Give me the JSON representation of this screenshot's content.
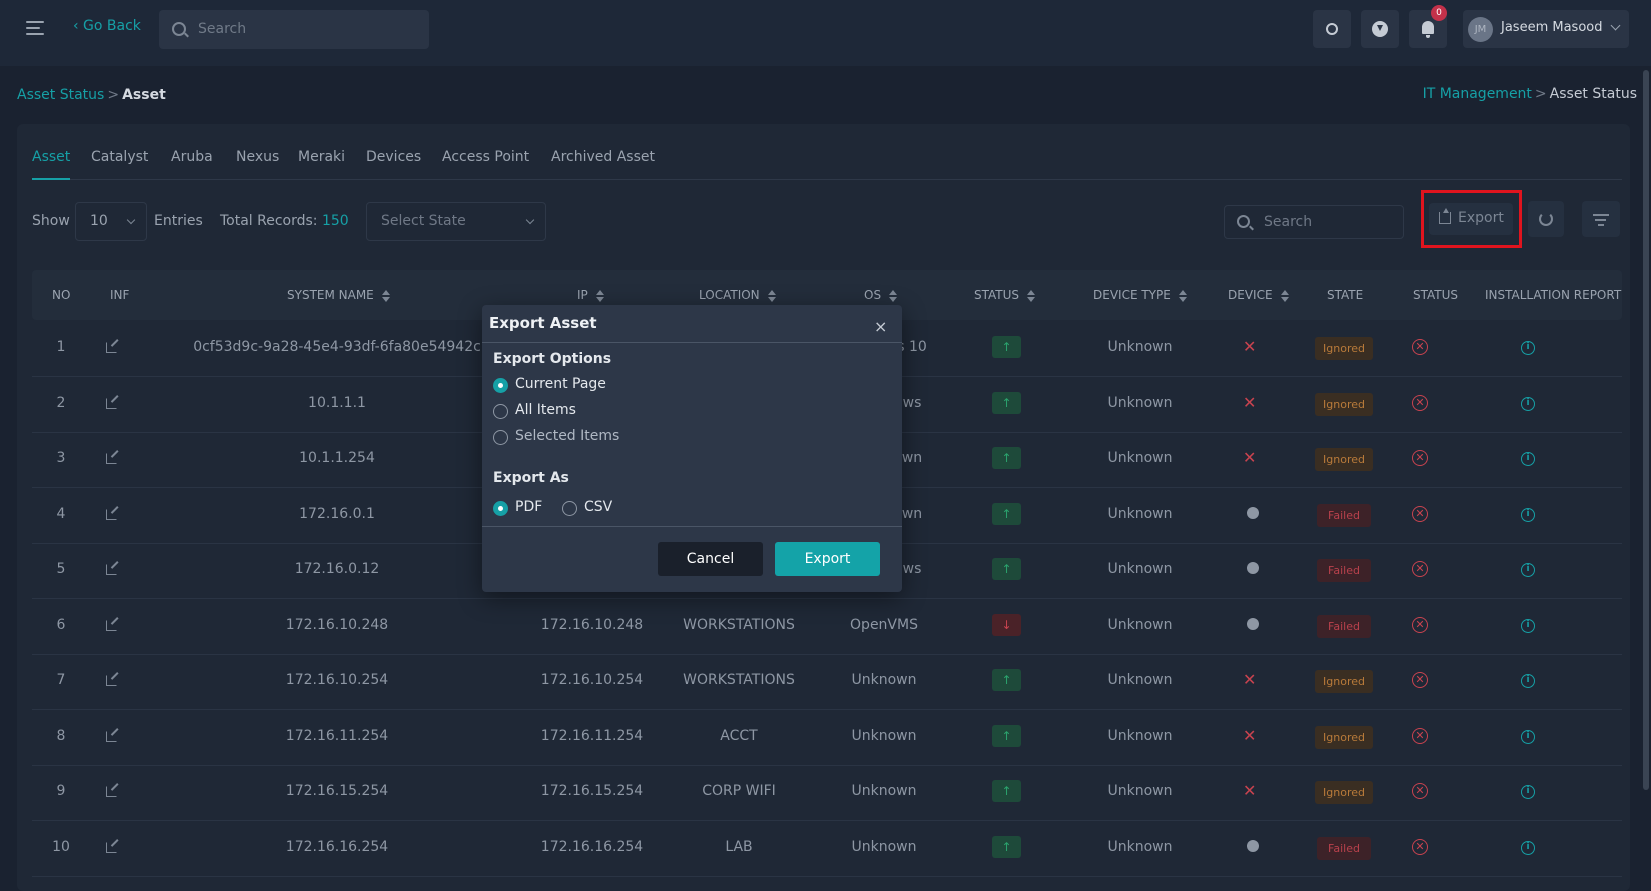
{
  "topbar": {
    "go_back": "‹ Go Back",
    "search_placeholder": "Search",
    "notification_count": "0",
    "user_initials": "JM",
    "user_name": "Jaseem Masood"
  },
  "breadcrumb_left": {
    "parent": "Asset Status",
    "sep": ">",
    "current": "Asset"
  },
  "breadcrumb_right": {
    "parent": "IT Management",
    "sep": ">",
    "current": "Asset Status"
  },
  "tabs": [
    "Asset",
    "Catalyst",
    "Aruba",
    "Nexus",
    "Meraki",
    "Devices",
    "Access Point",
    "Archived Asset"
  ],
  "toolbar": {
    "show_label": "Show",
    "entries_value": "10",
    "entries_label": "Entries",
    "total_label": "Total Records:",
    "total_value": "150",
    "state_placeholder": "Select State",
    "search_placeholder": "Search",
    "export_label": "Export"
  },
  "columns": [
    "NO",
    "INF",
    "SYSTEM NAME",
    "IP",
    "LOCATION",
    "OS",
    "STATUS",
    "DEVICE TYPE",
    "DEVICE",
    "STATE",
    "STATUS",
    "INSTALLATION REPORT"
  ],
  "rows": [
    {
      "no": "1",
      "system_name": "0cf53d9c-9a28-45e4-93df-6fa80e54942c",
      "ip": "",
      "location": "",
      "os": "s 10",
      "status": "up",
      "device_type": "Unknown",
      "device": "x",
      "state": "Ignored"
    },
    {
      "no": "2",
      "system_name": "10.1.1.1",
      "ip": "",
      "location": "",
      "os": "ws",
      "status": "up",
      "device_type": "Unknown",
      "device": "x",
      "state": "Ignored"
    },
    {
      "no": "3",
      "system_name": "10.1.1.254",
      "ip": "",
      "location": "",
      "os": "wn",
      "status": "up",
      "device_type": "Unknown",
      "device": "x",
      "state": "Ignored"
    },
    {
      "no": "4",
      "system_name": "172.16.0.1",
      "ip": "",
      "location": "",
      "os": "wn",
      "status": "up",
      "device_type": "Unknown",
      "device": "dot",
      "state": "Failed"
    },
    {
      "no": "5",
      "system_name": "172.16.0.12",
      "ip": "",
      "location": "",
      "os": "ws",
      "status": "up",
      "device_type": "Unknown",
      "device": "dot",
      "state": "Failed"
    },
    {
      "no": "6",
      "system_name": "172.16.10.248",
      "ip": "172.16.10.248",
      "location": "WORKSTATIONS",
      "os": "OpenVMS",
      "status": "down",
      "device_type": "Unknown",
      "device": "dot",
      "state": "Failed"
    },
    {
      "no": "7",
      "system_name": "172.16.10.254",
      "ip": "172.16.10.254",
      "location": "WORKSTATIONS",
      "os": "Unknown",
      "status": "up",
      "device_type": "Unknown",
      "device": "x",
      "state": "Ignored"
    },
    {
      "no": "8",
      "system_name": "172.16.11.254",
      "ip": "172.16.11.254",
      "location": "ACCT",
      "os": "Unknown",
      "status": "up",
      "device_type": "Unknown",
      "device": "x",
      "state": "Ignored"
    },
    {
      "no": "9",
      "system_name": "172.16.15.254",
      "ip": "172.16.15.254",
      "location": "CORP WIFI",
      "os": "Unknown",
      "status": "up",
      "device_type": "Unknown",
      "device": "x",
      "state": "Ignored"
    },
    {
      "no": "10",
      "system_name": "172.16.16.254",
      "ip": "172.16.16.254",
      "location": "LAB",
      "os": "Unknown",
      "status": "up",
      "device_type": "Unknown",
      "device": "dot",
      "state": "Failed"
    }
  ],
  "modal": {
    "title": "Export Asset",
    "close": "×",
    "options_label": "Export Options",
    "options": [
      "Current Page",
      "All Items",
      "Selected Items"
    ],
    "selected_option": "Current Page",
    "format_label": "Export As",
    "formats": [
      "PDF",
      "CSV"
    ],
    "selected_format": "PDF",
    "cancel_label": "Cancel",
    "export_label": "Export"
  },
  "colors": {
    "accent": "#16a0a6",
    "danger": "#c8434f",
    "success": "#2ba36d",
    "highlight_box": "#e0141e"
  }
}
